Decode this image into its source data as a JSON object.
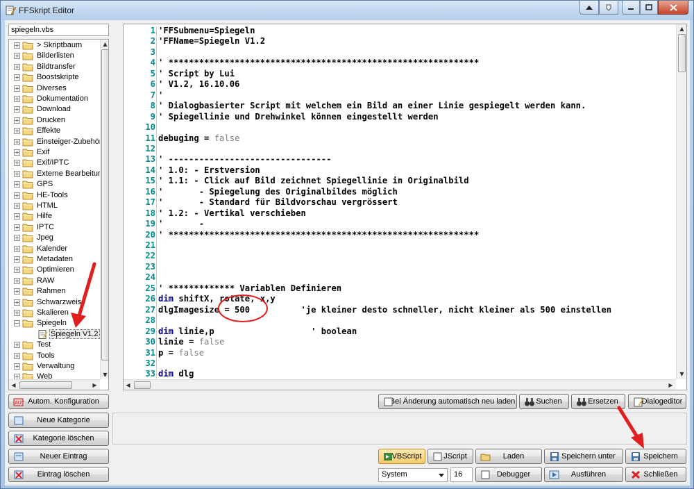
{
  "window": {
    "title": "FFSkript Editor"
  },
  "file": {
    "name": "spiegeln.vbs"
  },
  "tree": {
    "items": [
      {
        "label": "> Skriptbaum"
      },
      {
        "label": "Bilderlisten"
      },
      {
        "label": "Bildtransfer"
      },
      {
        "label": "Boostskripte"
      },
      {
        "label": "Diverses"
      },
      {
        "label": "Dokumentation"
      },
      {
        "label": "Download"
      },
      {
        "label": "Drucken"
      },
      {
        "label": "Effekte"
      },
      {
        "label": "Einsteiger-Zubehör"
      },
      {
        "label": "Exif"
      },
      {
        "label": "Exif/IPTC"
      },
      {
        "label": "Externe Bearbeitur"
      },
      {
        "label": "GPS"
      },
      {
        "label": "HE-Tools"
      },
      {
        "label": "HTML"
      },
      {
        "label": "Hilfe"
      },
      {
        "label": "IPTC"
      },
      {
        "label": "Jpeg"
      },
      {
        "label": "Kalender"
      },
      {
        "label": "Metadaten"
      },
      {
        "label": "Optimieren"
      },
      {
        "label": "RAW"
      },
      {
        "label": "Rahmen"
      },
      {
        "label": "Schwarzweiss"
      },
      {
        "label": "Skalieren"
      },
      {
        "label": "Spiegeln"
      },
      {
        "label": "Spiegeln V1.2"
      },
      {
        "label": "Test"
      },
      {
        "label": "Tools"
      },
      {
        "label": "Verwaltung"
      },
      {
        "label": "Web"
      }
    ]
  },
  "code": {
    "lines": [
      {
        "n": "1",
        "t": "'FFSubmenu=Spiegeln"
      },
      {
        "n": "2",
        "t": "'FFName=Spiegeln V1.2"
      },
      {
        "n": "3",
        "t": ""
      },
      {
        "n": "4",
        "t": "' *************************************************************"
      },
      {
        "n": "5",
        "t": "' Script by Lui"
      },
      {
        "n": "6",
        "t": "' V1.2, 16.10.06"
      },
      {
        "n": "7",
        "t": "'"
      },
      {
        "n": "8",
        "t": "' Dialogbasierter Script mit welchem ein Bild an einer Linie gespiegelt werden kann."
      },
      {
        "n": "9",
        "t": "' Spiegellinie und Drehwinkel können eingestellt werden"
      },
      {
        "n": "10",
        "t": ""
      },
      {
        "n": "11",
        "a": "debuging = ",
        "b": "false"
      },
      {
        "n": "12",
        "t": ""
      },
      {
        "n": "13",
        "t": "' --------------------------------"
      },
      {
        "n": "14",
        "t": "' 1.0: - Erstversion"
      },
      {
        "n": "15",
        "t": "' 1.1: - Click auf Bild zeichnet Spiegellinie in Originalbild"
      },
      {
        "n": "16",
        "t": "'       - Spiegelung des Originalbildes möglich"
      },
      {
        "n": "17",
        "t": "'       - Standard für Bildvorschau vergrössert"
      },
      {
        "n": "18",
        "t": "' 1.2: - Vertikal verschieben"
      },
      {
        "n": "19",
        "t": "'       -"
      },
      {
        "n": "20",
        "t": "' *************************************************************"
      },
      {
        "n": "21",
        "t": ""
      },
      {
        "n": "22",
        "t": ""
      },
      {
        "n": "23",
        "t": ""
      },
      {
        "n": "24",
        "t": ""
      },
      {
        "n": "25",
        "t": "' ************* Variablen Definieren"
      },
      {
        "n": "26",
        "k": "dim",
        "a": " shiftX, rotate, x,y"
      },
      {
        "n": "27",
        "t": "dlgImagesize = 500          'je kleiner desto schneller, nicht kleiner als 500 einstellen"
      },
      {
        "n": "28",
        "t": ""
      },
      {
        "n": "29",
        "k": "dim",
        "a": " linie,p                   ' boolean"
      },
      {
        "n": "30",
        "a": "linie = ",
        "b": "false"
      },
      {
        "n": "31",
        "a": "p = ",
        "b": "false"
      },
      {
        "n": "32",
        "t": ""
      },
      {
        "n": "33",
        "k": "dim",
        "a": " dlg"
      }
    ]
  },
  "buttons": {
    "auto_config": "Autom. Konfiguration",
    "new_category": "Neue Kategorie",
    "delete_category": "Kategorie löschen",
    "new_entry": "Neuer Eintrag",
    "delete_entry": "Eintrag löschen",
    "auto_reload": "Bei Änderung automatisch neu laden",
    "search": "Suchen",
    "replace": "Ersetzen",
    "dialog_editor": "Dialogeditor",
    "vbscript": "VBScript",
    "jscript": "JScript",
    "load": "Laden",
    "save_as": "Speichern unter",
    "save": "Speichern",
    "debugger": "Debugger",
    "run": "Ausführen",
    "close": "Schließen"
  },
  "settings": {
    "font_select": "System",
    "font_size": "16"
  },
  "colors": {
    "annotation": "#e02020",
    "line_numbers": "#008b8b",
    "keyword": "#00008b"
  }
}
